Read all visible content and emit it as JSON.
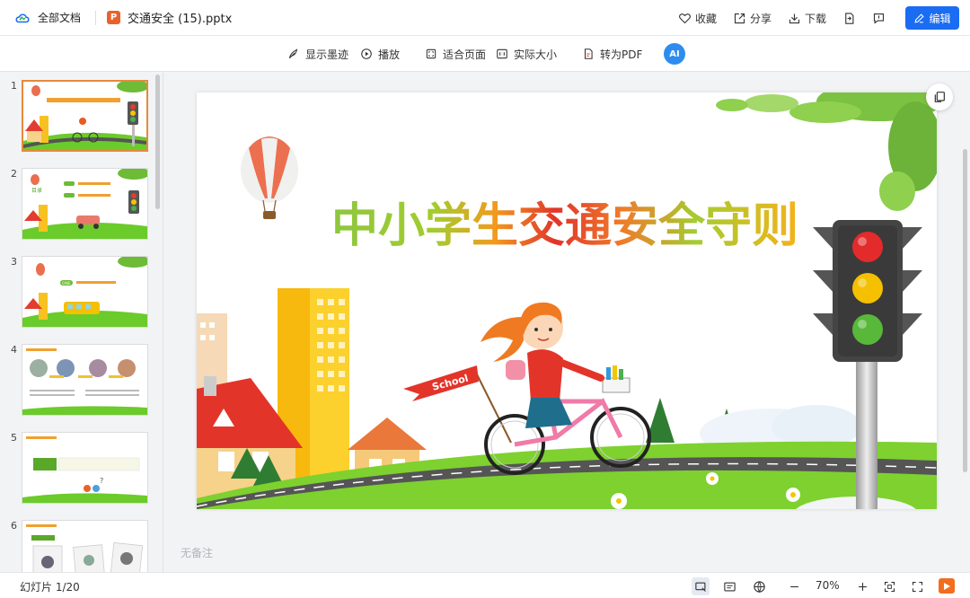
{
  "header": {
    "breadcrumb_root": "全部文档",
    "file_type_badge": "P",
    "file_name": "交通安全 (15).pptx",
    "buttons": {
      "favorite": "收藏",
      "share": "分享",
      "download": "下载",
      "edit": "编辑"
    }
  },
  "toolbar": {
    "show_ink": "显示墨迹",
    "play": "播放",
    "fit_page": "适合页面",
    "actual_size": "实际大小",
    "to_pdf": "转为PDF",
    "ai_badge": "AI"
  },
  "sidebar": {
    "thumbnails": [
      {
        "number": "1",
        "active": true
      },
      {
        "number": "2",
        "active": false
      },
      {
        "number": "3",
        "active": false
      },
      {
        "number": "4",
        "active": false
      },
      {
        "number": "5",
        "active": false
      },
      {
        "number": "6",
        "active": false
      }
    ],
    "thumb2_label": "目录",
    "thumb3_badge": "ONE"
  },
  "slide": {
    "title": "中小学生交通安全守则",
    "flag_text": "School"
  },
  "notes": {
    "placeholder": "无备注"
  },
  "statusbar": {
    "slide_counter": "幻灯片 1/20",
    "zoom": "70%"
  },
  "colors": {
    "accent_blue": "#1a6cf3",
    "active_thumb_border": "#e7893a",
    "ppt_orange": "#e9622c",
    "play_orange": "#f36d1f"
  }
}
